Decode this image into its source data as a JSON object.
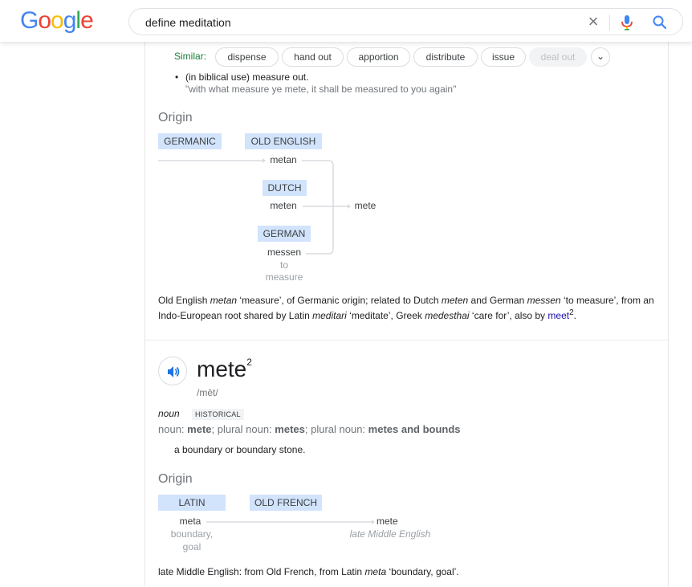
{
  "header": {
    "logo": [
      "G",
      "o",
      "o",
      "g",
      "l",
      "e"
    ],
    "logo_colors": [
      "#4285F4",
      "#EA4335",
      "#FBBC05",
      "#4285F4",
      "#34A853",
      "#EA4335"
    ],
    "search_value": "define meditation",
    "clear_icon": "×"
  },
  "entry1": {
    "similar_label": "Similar:",
    "chips": [
      "dispense",
      "hand out",
      "apportion",
      "distribute",
      "issue"
    ],
    "chip_disabled": "deal out",
    "expand_icon": "⌄",
    "bullet": "•",
    "sense_label": "(in biblical use) measure out.",
    "example": "\"with what measure ye mete, it shall be measured to you again\"",
    "origin_title": "Origin",
    "langs": {
      "germanic": "GERMANIC",
      "old_english": "OLD ENGLISH",
      "dutch": "DUTCH",
      "german": "GERMAN"
    },
    "words": {
      "metan": "metan",
      "meten": "meten",
      "mete": "mete",
      "messen": "messen",
      "gloss1": "to",
      "gloss2": "measure"
    },
    "etymology": {
      "t1": "Old English ",
      "i1": "metan",
      "t2": " ‘measure’, of Germanic origin; related to Dutch ",
      "i2": "meten",
      "t3": " and German ",
      "i3": "messen",
      "t4": " ‘to measure’, from an Indo-European root shared by Latin ",
      "i4": "meditari",
      "t5": " ‘meditate’, Greek ",
      "i5": "medesthai",
      "t6": " ‘care for’, also by ",
      "link": "meet",
      "sup": "2",
      "end": "."
    }
  },
  "entry2": {
    "headword": "mete",
    "sup": "2",
    "pron": "/mēt/",
    "pos": "noun",
    "badge": "HISTORICAL",
    "forms": {
      "p1": "noun: ",
      "b1": "mete",
      "p2": "; plural noun: ",
      "b2": "metes",
      "p3": "; plural noun: ",
      "b3": "metes and bounds"
    },
    "definition": "a boundary or boundary stone.",
    "origin_title": "Origin",
    "langs": {
      "latin": "LATIN",
      "old_french": "OLD FRENCH"
    },
    "words": {
      "meta": "meta",
      "gloss1": "boundary,",
      "gloss2": "goal",
      "mete": "mete",
      "period": "late Middle English"
    },
    "etymology": {
      "t1": "late Middle English: from Old French, from Latin ",
      "i1": "meta",
      "t2": " ‘boundary, goal’."
    }
  },
  "colors": {
    "accent": "#1a73e8",
    "similar": "#188038",
    "chip_border": "#dadce0",
    "lang_bg": "#d2e3fc"
  }
}
